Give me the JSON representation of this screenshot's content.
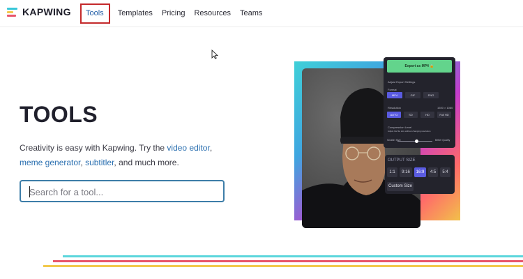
{
  "header": {
    "logo_text": "KAPWING",
    "nav": [
      {
        "label": "Tools",
        "active": true
      },
      {
        "label": "Templates"
      },
      {
        "label": "Pricing"
      },
      {
        "label": "Resources"
      },
      {
        "label": "Teams"
      }
    ]
  },
  "hero": {
    "title": "TOOLS",
    "desc_prefix": "Creativity is easy with Kapwing. Try the ",
    "link_video_editor": "video editor",
    "sep1": ", ",
    "link_meme_generator": "meme generator",
    "sep2": ", ",
    "link_subtitler": "subtitler",
    "desc_suffix": ", and much more.",
    "search_placeholder": "Search for a tool..."
  },
  "export_panel": {
    "export_button": "Export as MP4",
    "heading": "Adjust Export Settings",
    "format_label": "Format",
    "formats": [
      "MP4",
      "GIF",
      "PNG"
    ],
    "resolution_label": "Resolution",
    "resolution_value": "1920 × 1080",
    "resolutions": [
      "AUTO",
      "SD",
      "HD",
      "Full HD"
    ],
    "compression_label": "Compression Level",
    "compression_hint": "Adjust the file size without changing resolution",
    "smaller_label": "Smaller Size",
    "better_label": "Better Quality",
    "output_size_label": "OUTPUT SIZE",
    "sizes": [
      "1:1",
      "9:16",
      "16:9",
      "4:5",
      "5:4"
    ],
    "custom_size": "Custom Size",
    "compression_level": 0.55
  },
  "colors": {
    "accent_link": "#2a6fb0",
    "active_outline": "#c4292b",
    "selected_chip": "#5a5be0",
    "export_green": "#63d48c",
    "stripe_cyan": "#5cd6dc",
    "stripe_red": "#e8556a",
    "stripe_yellow": "#f2c94c"
  },
  "icons": [
    "kapwing-logo-icon",
    "cursor-arrow-icon",
    "lock-icon"
  ]
}
